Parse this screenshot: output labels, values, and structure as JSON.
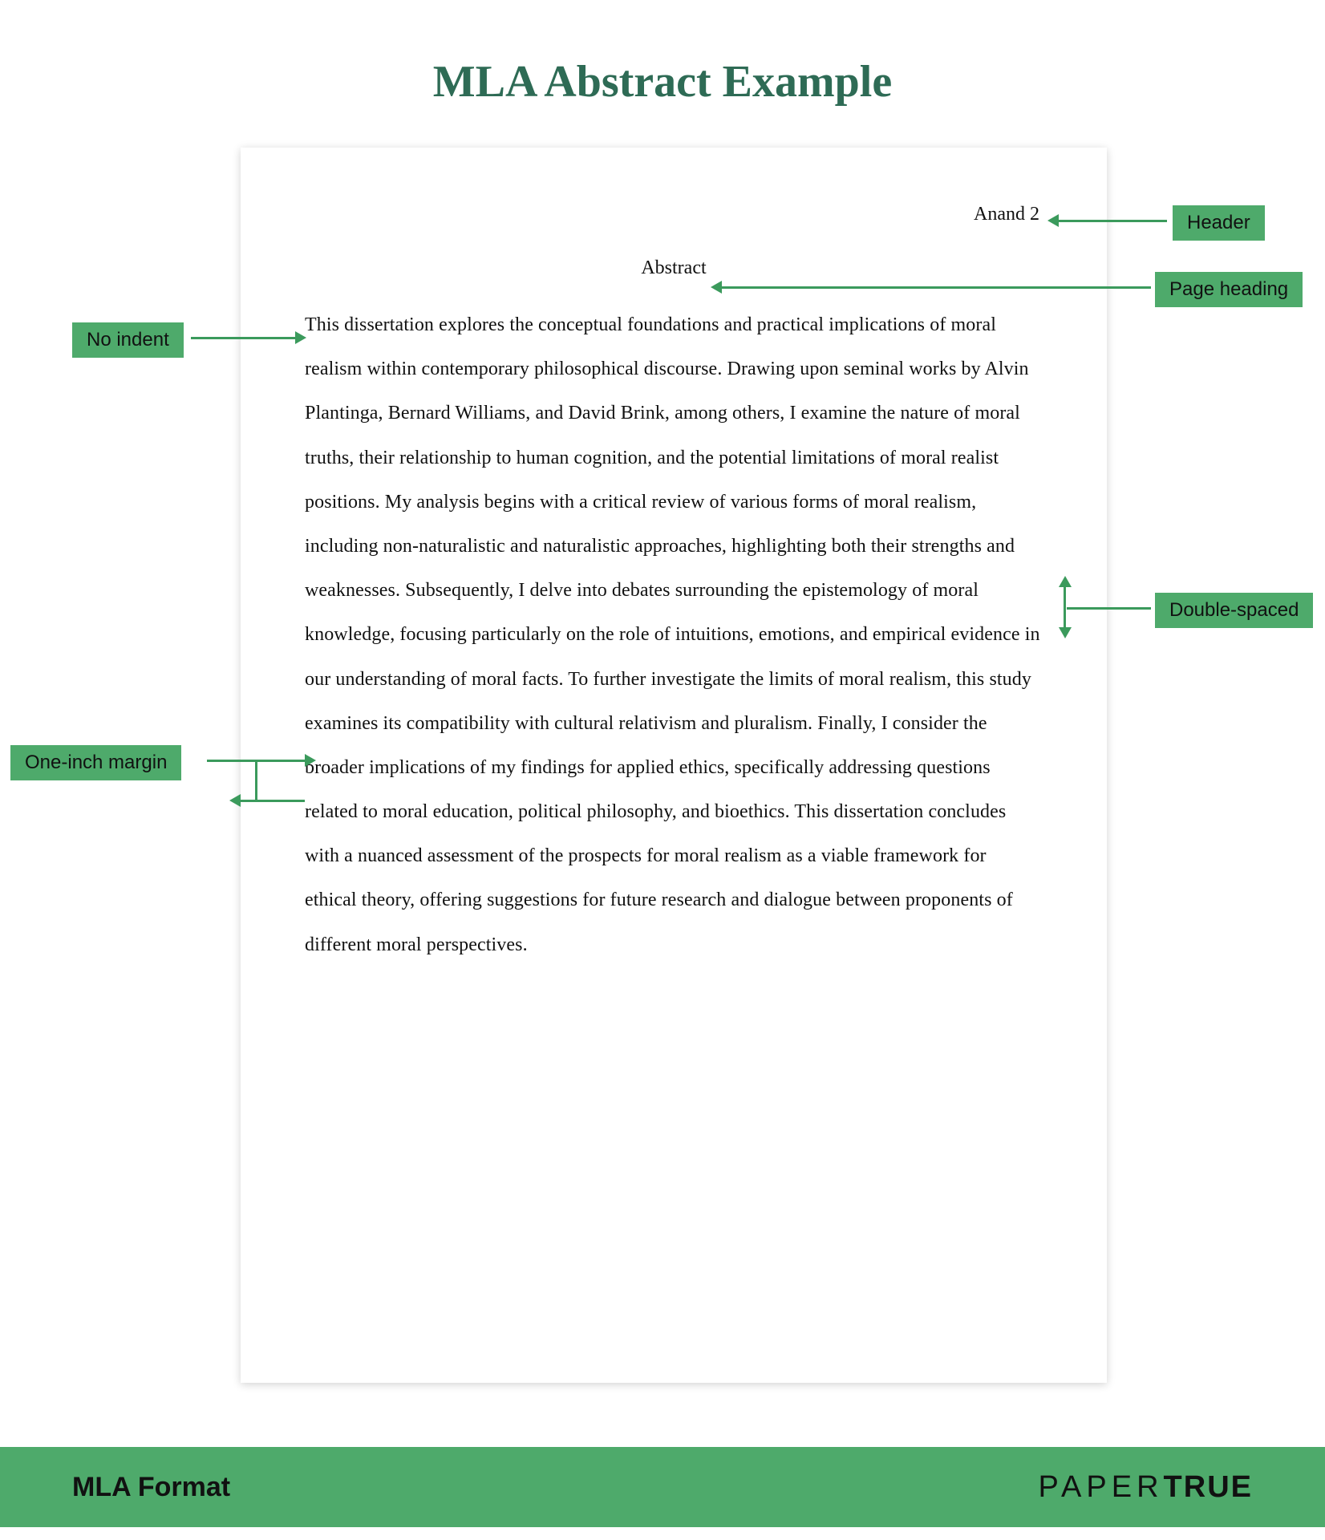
{
  "title": "MLA Abstract Example",
  "page": {
    "running_head": "Anand 2",
    "heading": "Abstract",
    "body": "This dissertation explores the conceptual foundations and practical implications of moral realism within contemporary philosophical discourse. Drawing upon seminal works by Alvin Plantinga, Bernard Williams, and David Brink, among others, I examine the nature of moral truths, their relationship to human cognition, and the potential limitations of moral realist positions. My analysis begins with a critical review of various forms of moral realism, including non-naturalistic and naturalistic approaches, highlighting both their strengths and weaknesses. Subsequently, I delve into debates surrounding the epistemology of moral knowledge, focusing particularly on the role of intuitions, emotions, and empirical evidence in our understanding of moral facts. To further investigate the limits of moral realism, this study examines its compatibility with cultural relativism and pluralism. Finally, I consider the broader implications of my findings for applied ethics, specifically addressing questions related to moral education, political philosophy, and bioethics. This dissertation concludes with a nuanced assessment of the prospects for moral realism as a viable framework for ethical theory, offering suggestions for future research and dialogue between proponents of different moral perspectives."
  },
  "annotations": {
    "header": "Header",
    "page_heading": "Page heading",
    "no_indent": "No indent",
    "double_spaced": "Double-spaced",
    "one_inch_margin": "One-inch margin"
  },
  "footer": {
    "left": "MLA Format",
    "logo_thin": "PAPER",
    "logo_bold": "TRUE"
  },
  "colors": {
    "accent": "#4eaa6b",
    "title": "#2e6b55"
  }
}
